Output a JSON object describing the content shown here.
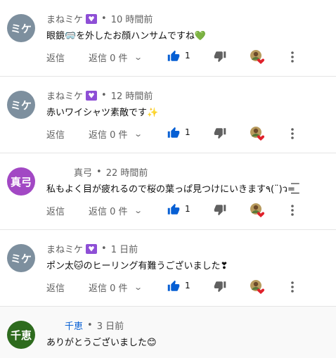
{
  "actions": {
    "reply_label": "返信",
    "view_replies_label": "返信 0 件"
  },
  "colors": {
    "like_blue": "#065fd4",
    "badge_purple": "#8e4fd6",
    "text_primary": "#0f0f0f",
    "text_secondary": "#606060"
  },
  "comments": [
    {
      "avatar_text": "ミケ",
      "avatar_color": "#7d8f9e",
      "author": "まねミケ",
      "has_badge": true,
      "time": "10 時間前",
      "text": "眼鏡🥽を外したお顔ハンサムですね💚",
      "likes": "1"
    },
    {
      "avatar_text": "ミケ",
      "avatar_color": "#7d8f9e",
      "author": "まねミケ",
      "has_badge": true,
      "time": "12 時間前",
      "text": "赤いワイシャツ素敵です✨",
      "likes": "1"
    },
    {
      "avatar_text": "真弓",
      "avatar_color": "#a248c4",
      "author": "真弓",
      "has_badge": false,
      "time": "22 時間前",
      "text": "私もよく目が疲れるので桜の葉っぱ見つけにいきます٩(¨)ว=͟͟͞͞",
      "likes": "1"
    },
    {
      "avatar_text": "ミケ",
      "avatar_color": "#7d8f9e",
      "author": "まねミケ",
      "has_badge": true,
      "time": "1 日前",
      "text": "ポン太🐱のヒーリング有難うございました❣",
      "likes": "1"
    },
    {
      "avatar_text": "千恵",
      "avatar_color": "#2e6b1e",
      "author": "千恵",
      "has_badge": false,
      "time": "3 日前",
      "text": "ありがとうございました😊"
    }
  ]
}
